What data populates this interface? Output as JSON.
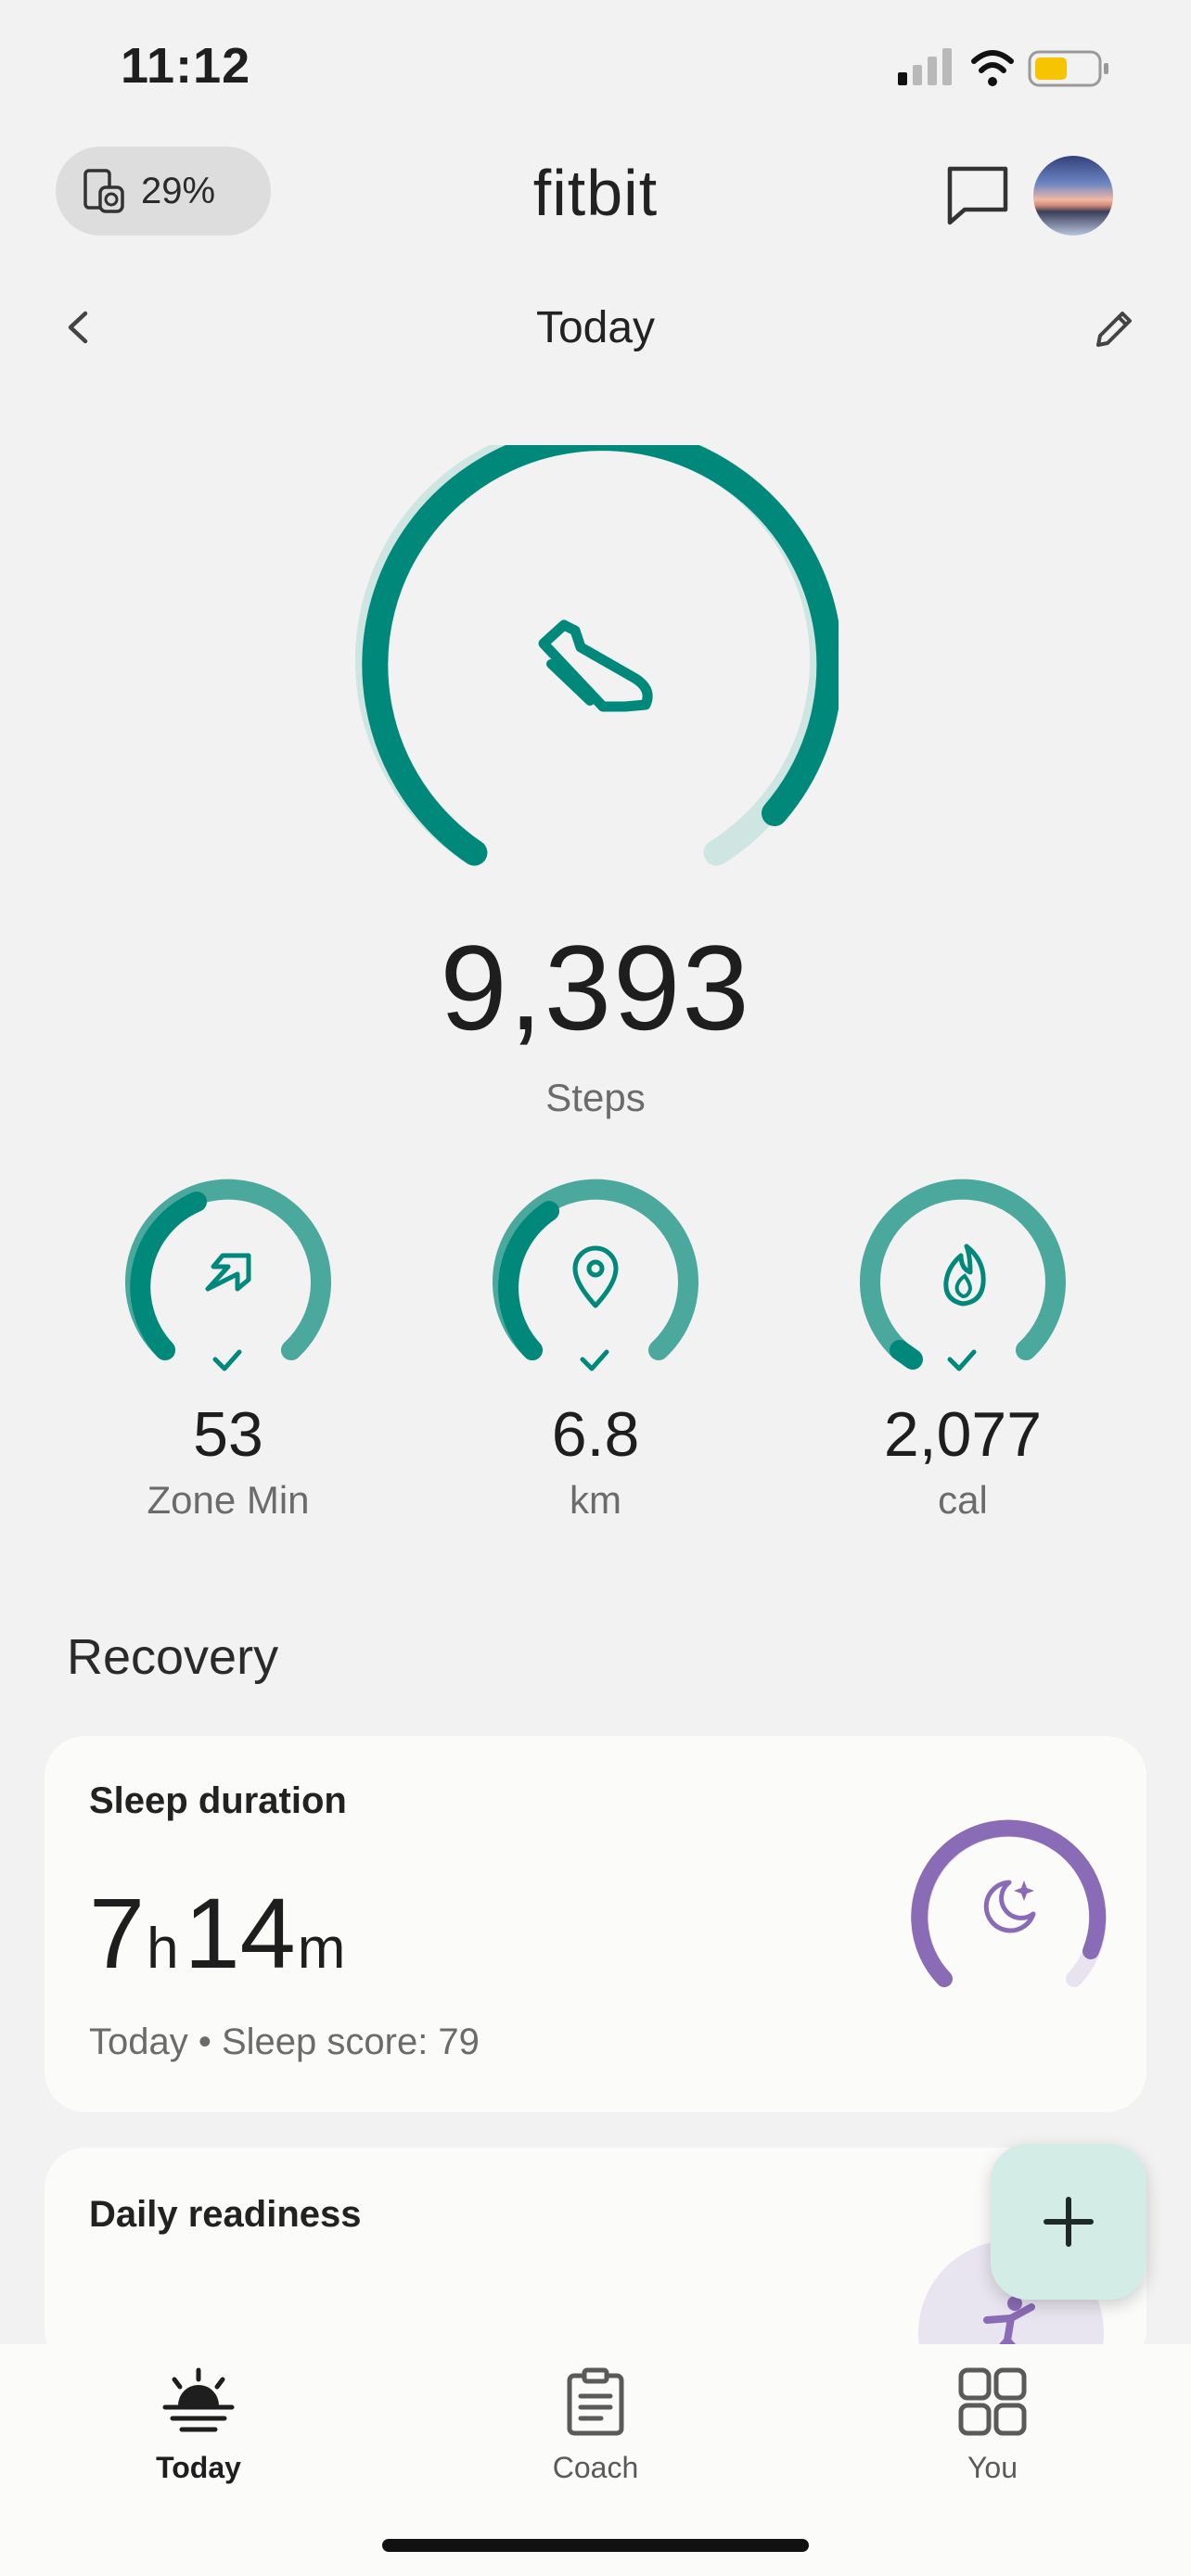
{
  "status_bar": {
    "time": "11:12"
  },
  "header": {
    "device_battery": "29%",
    "brand": "fitbit",
    "icons": [
      "device-icon",
      "message-icon",
      "avatar"
    ]
  },
  "date_nav": {
    "title": "Today",
    "icons": [
      "chevron-left-icon",
      "pencil-icon"
    ]
  },
  "steps": {
    "value": "9,393",
    "label": "Steps",
    "icon": "shoe-icon",
    "progress": 0.94
  },
  "stats": [
    {
      "value": "53",
      "label": "Zone Min",
      "icon": "zone-arrow-icon",
      "goal_met": true
    },
    {
      "value": "6.8",
      "label": "km",
      "icon": "location-pin-icon",
      "goal_met": true
    },
    {
      "value": "2,077",
      "label": "cal",
      "icon": "flame-icon",
      "goal_met": true
    }
  ],
  "recovery": {
    "title": "Recovery",
    "sleep": {
      "title": "Sleep duration",
      "hours": "7",
      "hours_unit": "h",
      "minutes": "14",
      "minutes_unit": "m",
      "subtitle": "Today • Sleep score: 79",
      "icon": "moon-star-icon",
      "progress": 0.9
    },
    "readiness": {
      "title": "Daily readiness",
      "icon": "readiness-figure-icon"
    }
  },
  "fab": {
    "icon": "plus-icon"
  },
  "bottom_nav": {
    "tabs": [
      {
        "label": "Today",
        "icon": "sunrise-icon",
        "active": true
      },
      {
        "label": "Coach",
        "icon": "clipboard-icon",
        "active": false
      },
      {
        "label": "You",
        "icon": "grid-icon",
        "active": false
      }
    ]
  },
  "colors": {
    "teal": "#00897b",
    "teal_light": "#4aa89c",
    "teal_track": "#cfe5e1",
    "purple": "#8a6bb5",
    "purple_track": "#e8e4ef",
    "background": "#f1f2f1"
  }
}
